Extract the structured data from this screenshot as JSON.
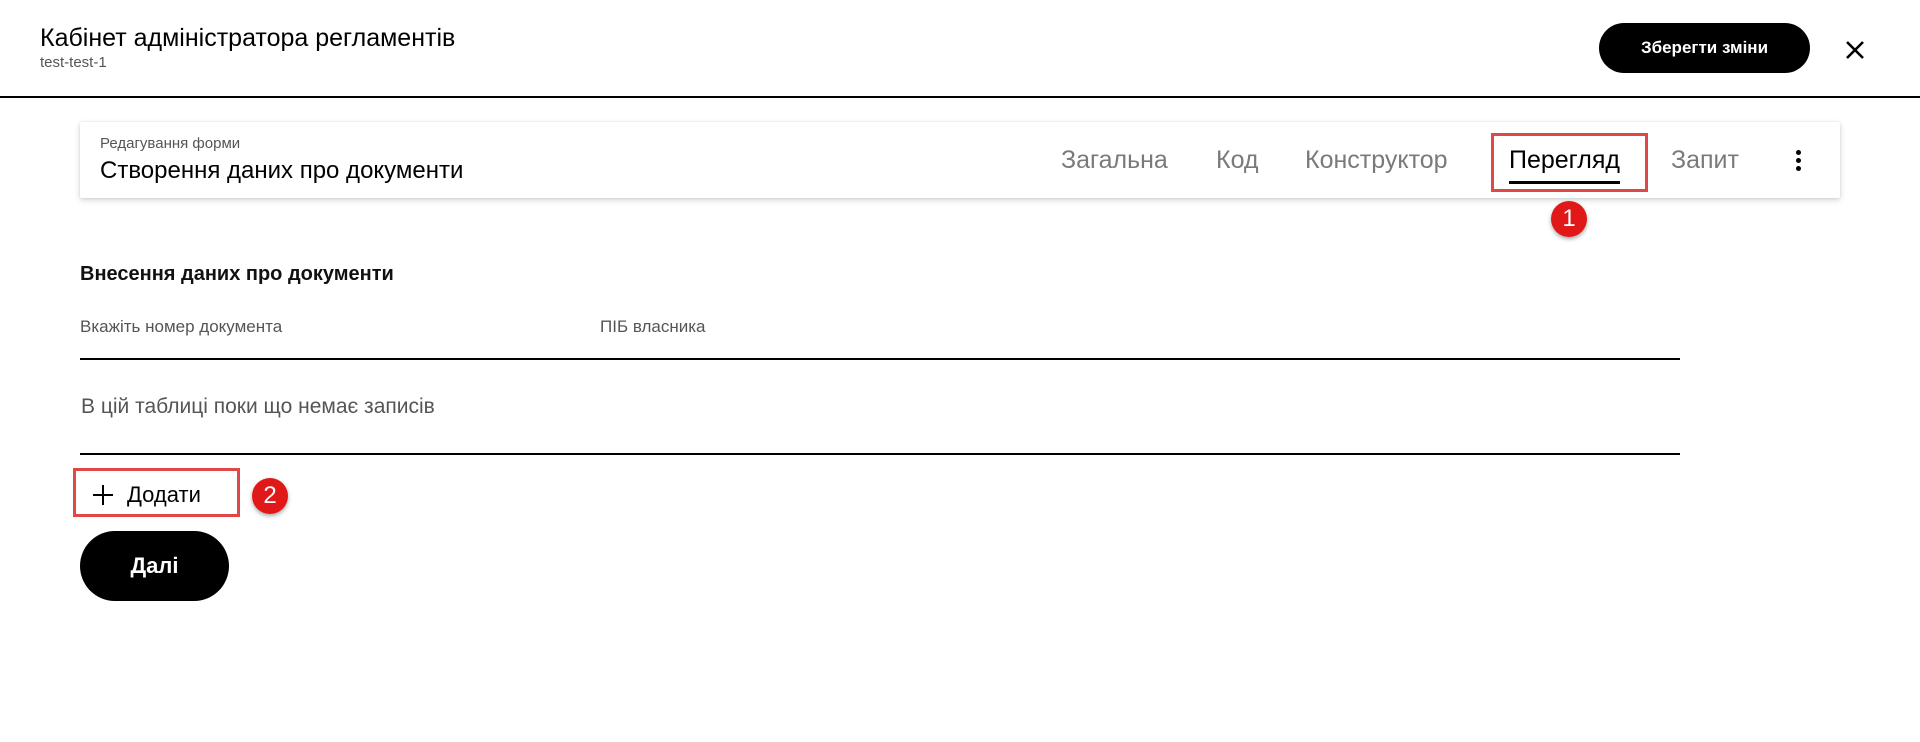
{
  "header": {
    "title": "Кабінет адміністратора регламентів",
    "subtitle": "test-test-1",
    "save_label": "Зберегти зміни",
    "close_icon": "close-icon"
  },
  "form_card": {
    "caption": "Редагування форми",
    "title": "Створення даних про документи",
    "tabs": [
      {
        "label": "Загальна",
        "active": false
      },
      {
        "label": "Код",
        "active": false
      },
      {
        "label": "Конструктор",
        "active": false
      },
      {
        "label": "Перегляд",
        "active": true
      },
      {
        "label": "Запит",
        "active": false
      }
    ],
    "more_icon": "more-vertical-icon"
  },
  "content": {
    "section_title": "Внесення даних про документи",
    "columns": [
      "Вкажіть номер документа",
      "ПІБ власника"
    ],
    "empty_text": "В цій таблиці поки що немає записів",
    "add_label": "Додати",
    "add_icon": "plus-icon",
    "next_label": "Далі"
  },
  "annotations": {
    "marker_1": "1",
    "marker_2": "2",
    "highlight_color": "#e04848",
    "marker_color": "#e01818"
  }
}
